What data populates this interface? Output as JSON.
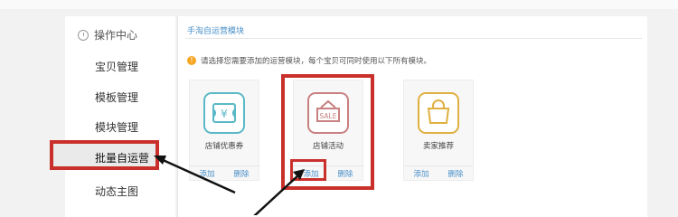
{
  "sidebar": {
    "header": "操作中心",
    "items": [
      "宝贝管理",
      "模板管理",
      "模块管理",
      "批量自运营",
      "动态主图"
    ]
  },
  "main": {
    "title": "手淘自运营模块",
    "notice": "请选择您需要添加的运营模块，每个宝贝可同时使用以下所有模块。",
    "cards": [
      {
        "icon": "coupon-icon",
        "label": "店铺优惠券",
        "add": "添加",
        "delete": "删除"
      },
      {
        "icon": "sale-icon",
        "icon_text": "SALE",
        "label": "店铺活动",
        "add": "添加",
        "delete": "删除"
      },
      {
        "icon": "shopping-bag-icon",
        "label": "卖家推荐",
        "add": "添加",
        "delete": "删除"
      }
    ]
  },
  "colors": {
    "highlight": "#c9302c",
    "link": "#4a90c8",
    "coupon": "#5bb8c8",
    "sale": "#c98080",
    "bag": "#e0b040"
  }
}
